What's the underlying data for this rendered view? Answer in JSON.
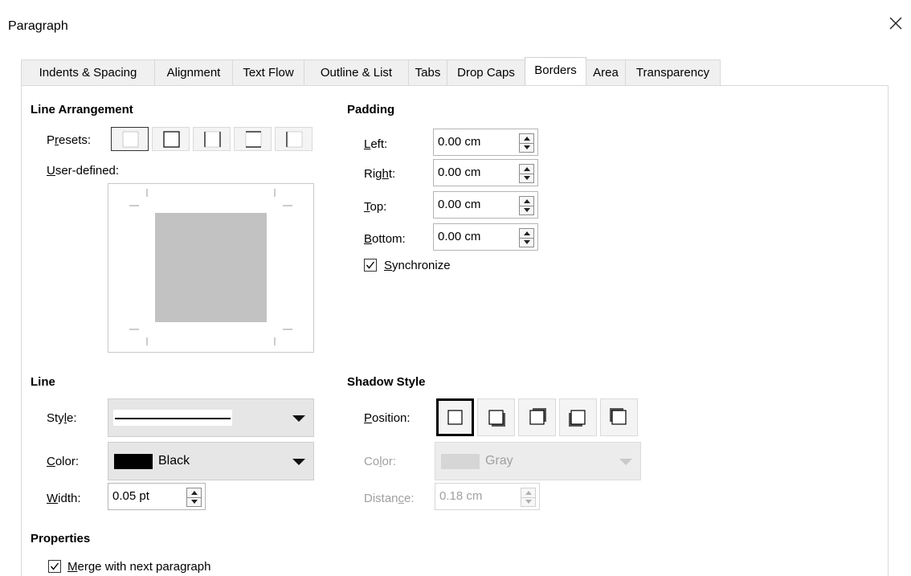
{
  "window": {
    "title": "Paragraph",
    "close_icon": "close-icon"
  },
  "tabs": [
    {
      "label": "Indents & Spacing",
      "active": false
    },
    {
      "label": "Alignment",
      "active": false
    },
    {
      "label": "Text Flow",
      "active": false
    },
    {
      "label": "Outline & List",
      "active": false
    },
    {
      "label": "Tabs",
      "active": false
    },
    {
      "label": "Drop Caps",
      "active": false
    },
    {
      "label": "Borders",
      "active": true
    },
    {
      "label": "Area",
      "active": false
    },
    {
      "label": "Transparency",
      "active": false
    }
  ],
  "line_arrangement": {
    "heading": "Line Arrangement",
    "presets_label_pre": "P",
    "presets_label_ul": "r",
    "presets_label_post": "esets:",
    "user_defined_ul": "U",
    "user_defined_post": "ser-defined:"
  },
  "padding": {
    "heading": "Padding",
    "left": {
      "ul": "L",
      "rest": "eft:",
      "value": "0.00 cm"
    },
    "right": {
      "pre": "Rig",
      "ul": "h",
      "rest": "t:",
      "value": "0.00 cm"
    },
    "top": {
      "ul": "T",
      "rest": "op:",
      "value": "0.00 cm"
    },
    "bottom": {
      "ul": "B",
      "rest": "ottom:",
      "value": "0.00 cm"
    },
    "synchronize": {
      "ul": "S",
      "rest": "ynchronize",
      "checked": true
    }
  },
  "line": {
    "heading": "Line",
    "style": {
      "pre": "Sty",
      "ul": "l",
      "rest": "e:"
    },
    "color": {
      "ul": "C",
      "rest": "olor:",
      "value": "Black",
      "swatch": "#000000"
    },
    "width": {
      "ul": "W",
      "rest": "idth:",
      "value": "0.05 pt"
    }
  },
  "shadow_style": {
    "heading": "Shadow Style",
    "position": {
      "ul": "P",
      "rest": "osition:"
    },
    "color": {
      "pre": "Co",
      "ul": "l",
      "rest": "or:",
      "value": "Gray",
      "swatch": "#cccccc"
    },
    "distance": {
      "pre": "Distan",
      "ul": "c",
      "rest": "e:",
      "value": "0.18 cm"
    }
  },
  "properties": {
    "heading": "Properties",
    "merge": {
      "ul": "M",
      "rest": "erge with next paragraph",
      "checked": true
    }
  }
}
